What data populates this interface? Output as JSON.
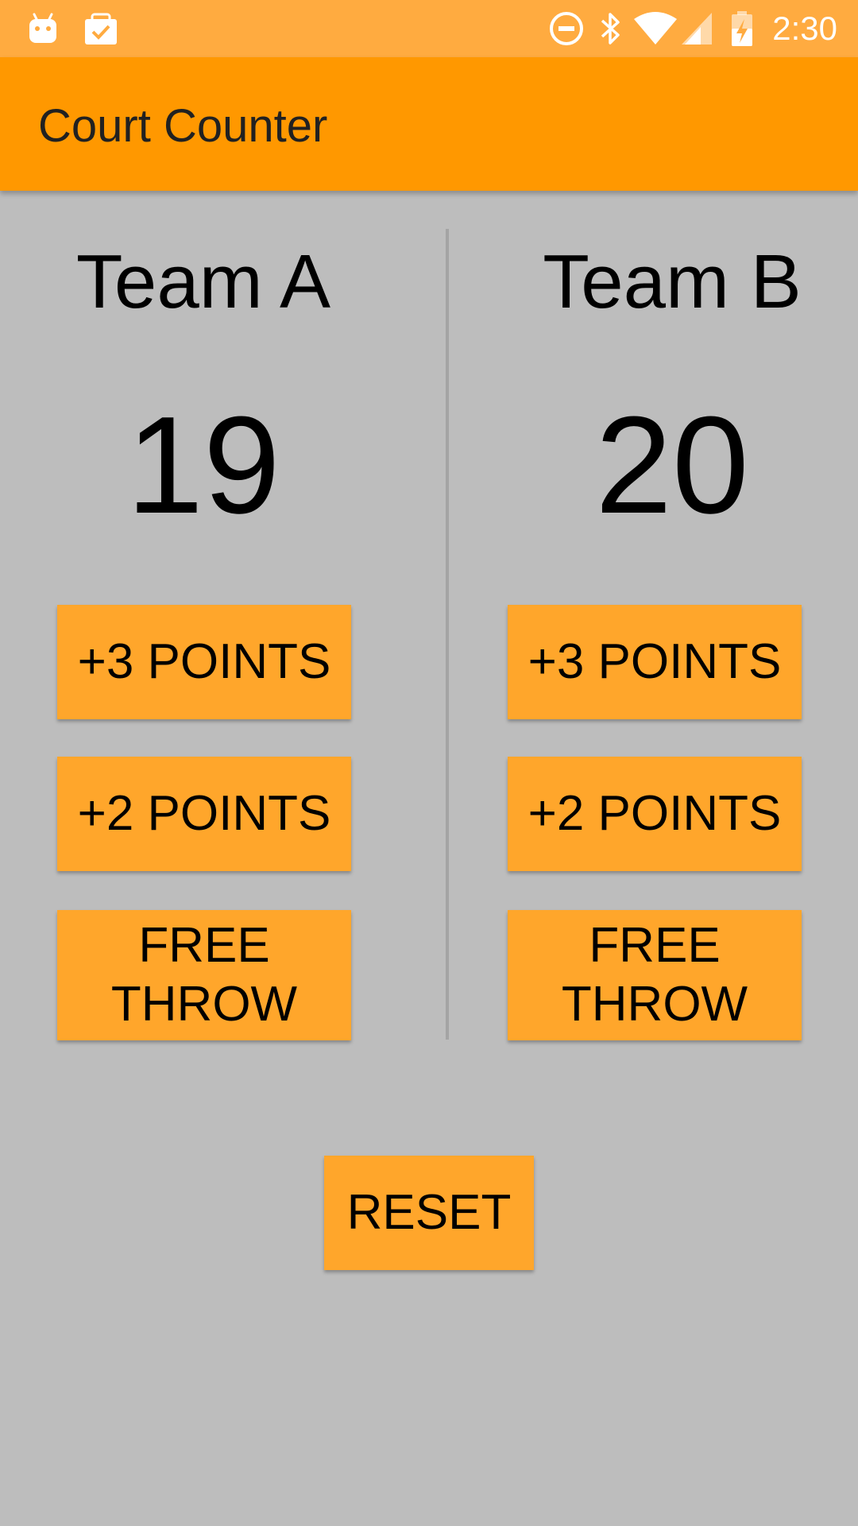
{
  "status_bar": {
    "time": "2:30",
    "left_icons": [
      "android-debug-icon",
      "clipboard-check-icon"
    ],
    "right_icons": [
      "do-not-disturb-icon",
      "bluetooth-icon",
      "wifi-icon",
      "cell-signal-icon",
      "battery-charging-icon"
    ]
  },
  "app_bar": {
    "title": "Court Counter"
  },
  "team_a": {
    "name": "Team A",
    "score": "19",
    "three_points_label": "+3 POINTS",
    "two_points_label": "+2 POINTS",
    "free_throw_label_line1": "FREE",
    "free_throw_label_line2": "THROW"
  },
  "team_b": {
    "name": "Team B",
    "score": "20",
    "three_points_label": "+3 POINTS",
    "two_points_label": "+2 POINTS",
    "free_throw_label_line1": "FREE",
    "free_throw_label_line2": "THROW"
  },
  "reset_label": "RESET",
  "colors": {
    "status_bar": "#ffab40",
    "app_bar": "#ff9800",
    "background": "#bdbdbd",
    "button": "#ffa62b"
  }
}
